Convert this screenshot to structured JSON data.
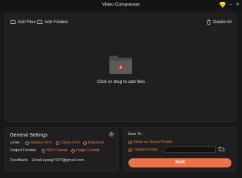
{
  "window": {
    "title": "Video Compressor"
  },
  "toolbar": {
    "add_files_label": "Add Files",
    "add_folders_label": "Add Folders",
    "delete_all_label": "Delete All"
  },
  "dropzone": {
    "text": "Click or drag to add files"
  },
  "general_settings": {
    "title": "General Settings",
    "level_label": "Level:",
    "level_options": [
      "Reduce First",
      "Clarity First",
      "Balanced"
    ],
    "output_format_label": "Output Format:",
    "format_options": [
      "MP4 Format",
      "Origin Format"
    ],
    "feedback_label": "Feedback:",
    "feedback_email": "Email zyang7027@gmail.com"
  },
  "save_to": {
    "title": "Save To:",
    "options": [
      "Same as Source Folder",
      "Custom Folder"
    ],
    "path_value": "--",
    "start_label": "Start"
  },
  "colors": {
    "accent": "#ef7148",
    "background": "#181818",
    "panel": "#1f1f1f"
  },
  "icons": {
    "premium": "diamond-icon",
    "add_files": "folder-icon",
    "add_folders": "folder-icon",
    "delete_all": "trash-icon",
    "dropzone": "folder-add-icon",
    "settings": "gear-icon",
    "browse": "folder-icon"
  }
}
